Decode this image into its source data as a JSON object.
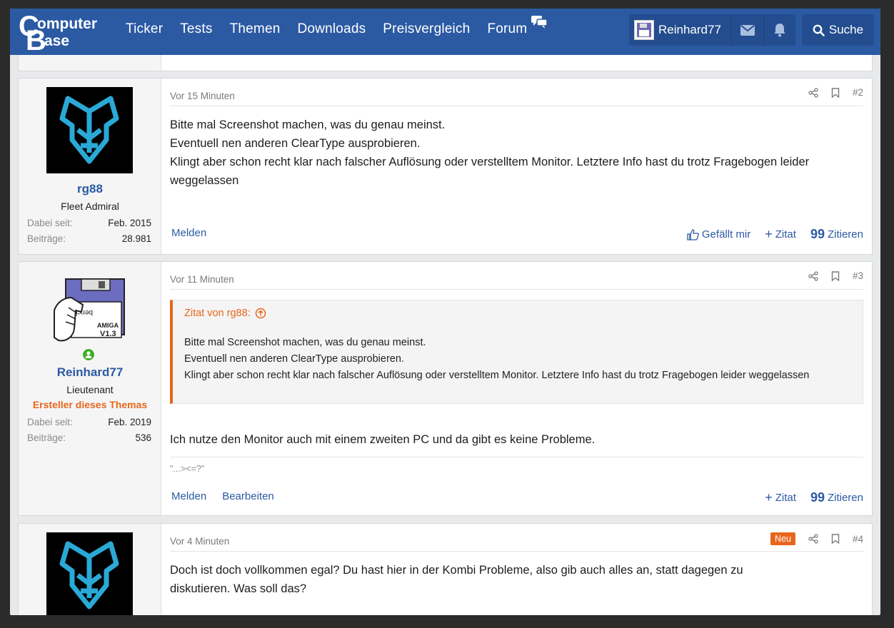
{
  "nav": {
    "logo_alt": "ComputerBase",
    "items": [
      "Ticker",
      "Tests",
      "Themen",
      "Downloads",
      "Preisvergleich",
      "Forum"
    ],
    "username": "Reinhard77",
    "search_label": "Suche"
  },
  "posts": [
    {
      "time": "Vor 15 Minuten",
      "number": "#2",
      "author": "rg88",
      "rank": "Fleet Admiral",
      "since_label": "Dabei seit:",
      "since": "Feb. 2015",
      "posts_label": "Beiträge:",
      "posts": "28.981",
      "lines": [
        "Bitte mal Screenshot machen, was du genau meinst.",
        "Eventuell nen anderen ClearType ausprobieren.",
        "Klingt aber schon recht klar nach falscher Auflösung oder verstelltem Monitor. Letztere Info hast du trotz Fragebogen leider weggelassen"
      ],
      "report": "Melden",
      "like": "Gefällt mir",
      "quote_plus": "Zitat",
      "cite": "Zitieren"
    },
    {
      "time": "Vor 11 Minuten",
      "number": "#3",
      "author": "Reinhard77",
      "rank": "Lieutenant",
      "starter": "Ersteller dieses Themas",
      "since_label": "Dabei seit:",
      "since": "Feb. 2019",
      "posts_label": "Beiträge:",
      "posts": "536",
      "quote_head": "Zitat von rg88:",
      "quote_lines": [
        "Bitte mal Screenshot machen, was du genau meinst.",
        "Eventuell nen anderen ClearType ausprobieren.",
        "Klingt aber schon recht klar nach falscher Auflösung oder verstelltem Monitor. Letztere Info hast du trotz Fragebogen leider weggelassen"
      ],
      "text": "Ich nutze den Monitor auch mit einem zweiten PC und da gibt es keine Probleme.",
      "signature": "\"...><=?\"",
      "report": "Melden",
      "edit": "Bearbeiten",
      "quote_plus": "Zitat",
      "cite": "Zitieren"
    },
    {
      "time": "Vor 4 Minuten",
      "number": "#4",
      "badge": "Neu",
      "lines": [
        "Doch ist doch vollkommen egal? Du hast hier in der Kombi Probleme, also gib auch alles an, statt dagegen zu",
        "diskutieren. Was soll das?"
      ]
    }
  ],
  "colors": {
    "header": "#2b5aa3",
    "accent_orange": "#e8661c",
    "link": "#2b5aa3",
    "avatar_cyan": "#2aa9d6"
  }
}
